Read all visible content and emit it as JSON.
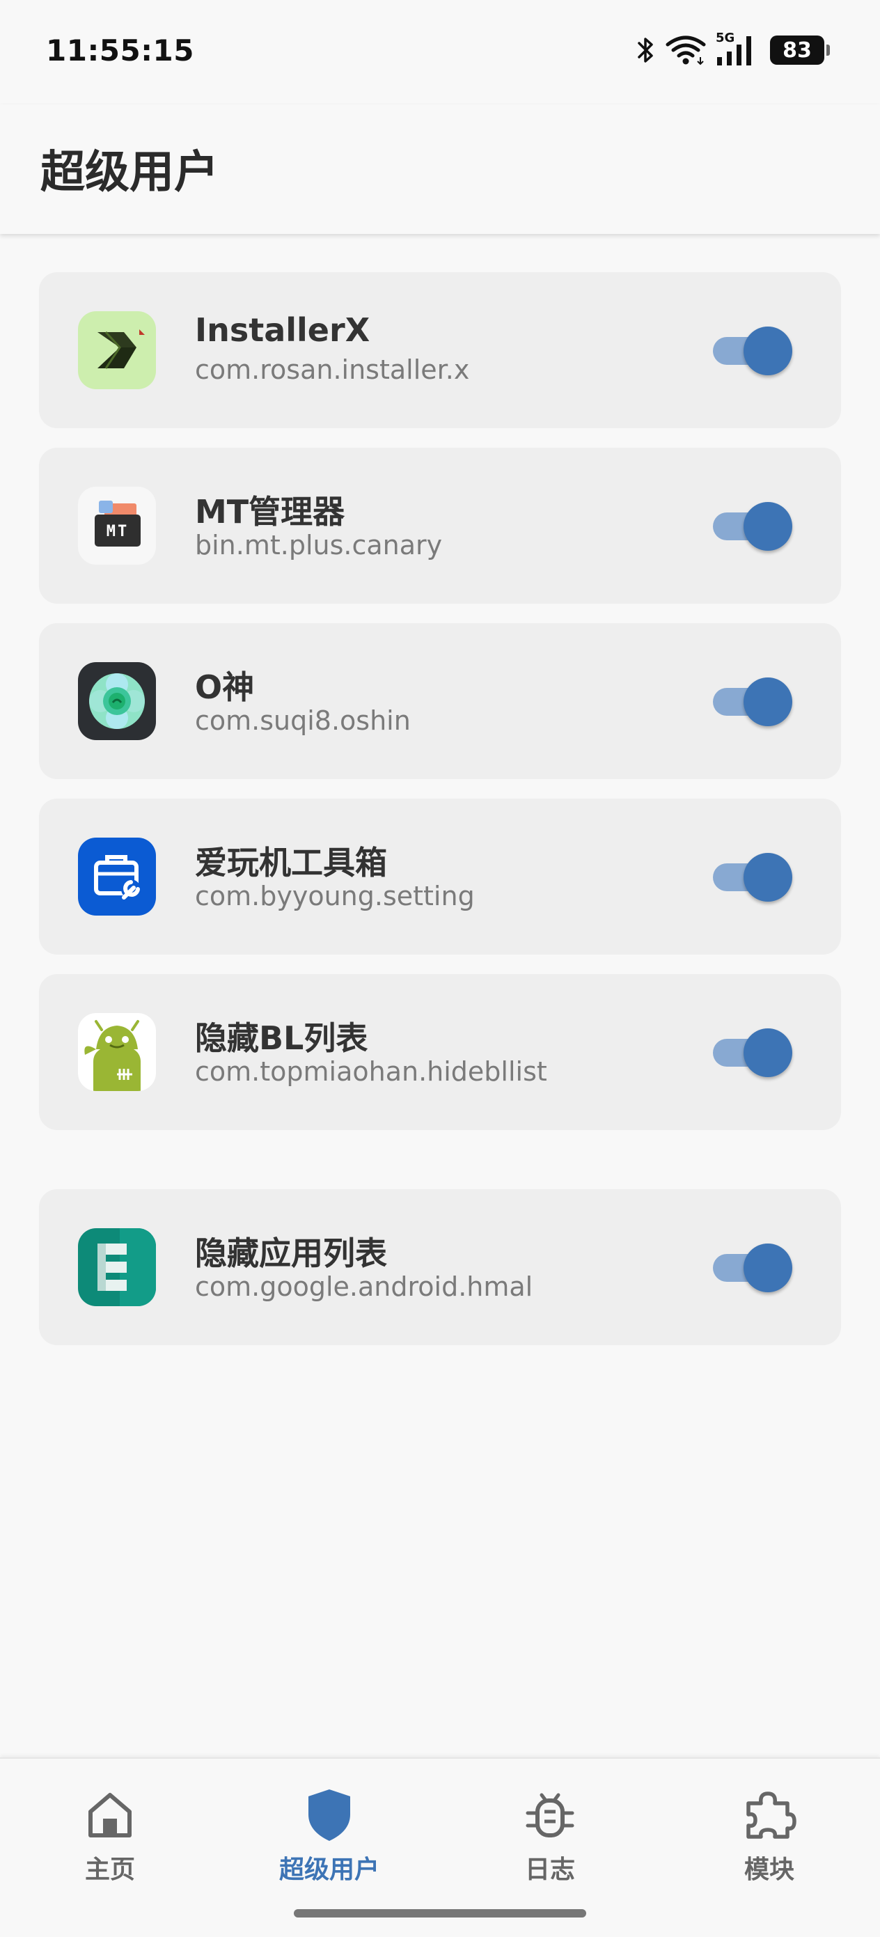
{
  "status_bar": {
    "time": "11:55:15",
    "network_label": "5G",
    "battery": "83",
    "icons": [
      "bluetooth-icon",
      "wifi-icon",
      "signal-icon",
      "battery-icon"
    ]
  },
  "header": {
    "title": "超级用户"
  },
  "apps": [
    {
      "name": "InstallerX",
      "package": "com.rosan.installer.x",
      "enabled": true,
      "icon": "installerx-app-icon"
    },
    {
      "name": "MT管理器",
      "package": "bin.mt.plus.canary",
      "enabled": true,
      "icon": "mt-manager-app-icon",
      "icon_text": "MT"
    },
    {
      "name": "O神",
      "package": "com.suqi8.oshin",
      "enabled": true,
      "icon": "oshin-app-icon"
    },
    {
      "name": "爱玩机工具箱",
      "package": "com.byyoung.setting",
      "enabled": true,
      "icon": "toolbox-app-icon"
    },
    {
      "name": "隐藏BL列表",
      "package": "com.topmiaohan.hidebllist",
      "enabled": true,
      "icon": "hidebl-app-icon"
    },
    {
      "name": "隐藏应用列表",
      "package": "com.google.android.hmal",
      "enabled": true,
      "icon": "hma-app-icon"
    }
  ],
  "bottom_nav": {
    "items": [
      {
        "label": "主页",
        "icon": "home-icon",
        "active": false
      },
      {
        "label": "超级用户",
        "icon": "shield-icon",
        "active": true
      },
      {
        "label": "日志",
        "icon": "bug-icon",
        "active": false
      },
      {
        "label": "模块",
        "icon": "puzzle-icon",
        "active": false
      }
    ]
  },
  "colors": {
    "accent": "#3d74b5",
    "toggle_track": "#88a9d2",
    "card_background": "#eeeeee",
    "page_background": "#f8f8f8"
  }
}
